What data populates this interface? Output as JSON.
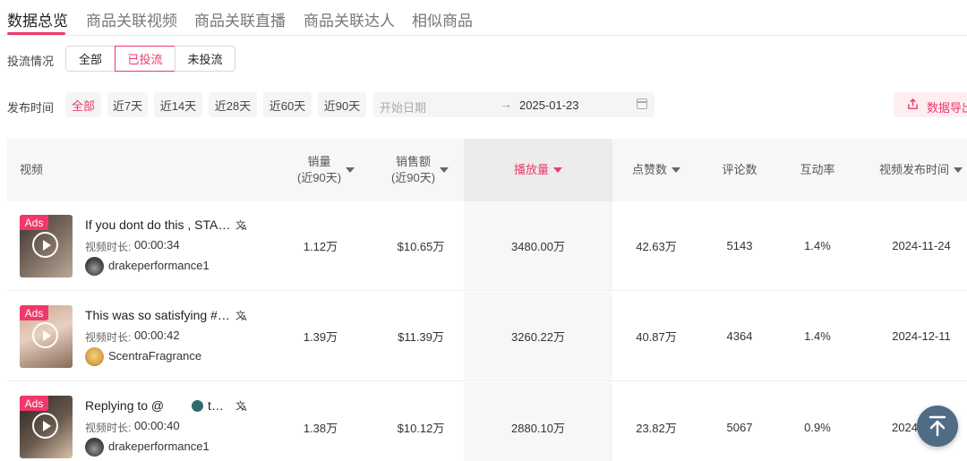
{
  "tabs": [
    "数据总览",
    "商品关联视频",
    "商品关联直播",
    "商品关联达人",
    "相似商品"
  ],
  "active_tab": 0,
  "ad_filter": {
    "label": "投流情况",
    "options": [
      "全部",
      "已投流",
      "未投流"
    ],
    "selected": "已投流"
  },
  "publish_time": {
    "label": "发布时间",
    "options": [
      "全部",
      "近7天",
      "近14天",
      "近28天",
      "近60天",
      "近90天"
    ],
    "selected": "全部",
    "start_placeholder": "开始日期",
    "arrow": "→",
    "end_value": "2025-01-23"
  },
  "export_label": "数据导出",
  "table": {
    "headers": {
      "video": "视频",
      "sales_line1": "销量",
      "sales_line2": "(近90天)",
      "revenue_line1": "销售额",
      "revenue_line2": "(近90天)",
      "plays": "播放量",
      "likes": "点赞数",
      "comments": "评论数",
      "engagement": "互动率",
      "publish_date": "视频发布时间"
    },
    "sorted_column": "播放量",
    "duration_label": "视频时长:",
    "ads_badge": "Ads",
    "rows": [
      {
        "title": "If you dont do this , STAR…",
        "duration": "00:00:34",
        "author": "drakeperformance1",
        "sales": "1.12万",
        "revenue": "$10.65万",
        "plays": "3480.00万",
        "likes": "42.63万",
        "comments": "5143",
        "engagement": "1.4%",
        "date": "2024-11-24"
      },
      {
        "title": "This was so satisfying #tt…",
        "duration": "00:00:42",
        "author": "ScentraFragrance",
        "sales": "1.39万",
        "revenue": "$11.39万",
        "plays": "3260.22万",
        "likes": "40.87万",
        "comments": "4364",
        "engagement": "1.4%",
        "date": "2024-12-11"
      },
      {
        "title": "Replying to @",
        "mention_rest": "t…",
        "duration": "00:00:40",
        "author": "drakeperformance1",
        "sales": "1.38万",
        "revenue": "$10.12万",
        "plays": "2880.10万",
        "likes": "23.82万",
        "comments": "5067",
        "engagement": "0.9%",
        "date": "2024"
      }
    ]
  },
  "colors": {
    "accent": "#f0386b",
    "fab": "#4f6b86"
  },
  "icons": [
    "translate-icon",
    "calendar-icon",
    "export-icon",
    "play-icon",
    "back-to-top-icon"
  ]
}
